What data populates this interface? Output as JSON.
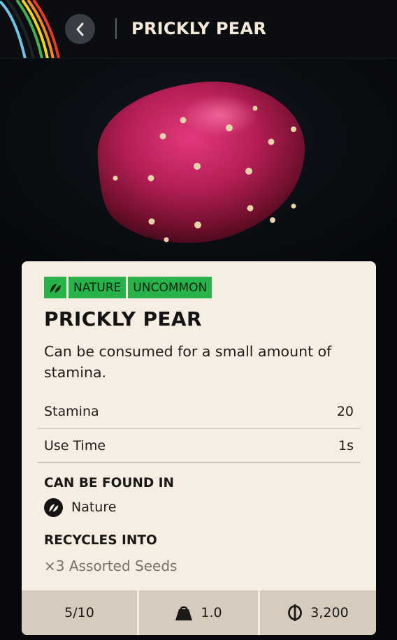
{
  "header": {
    "title": "PRICKLY PEAR"
  },
  "item": {
    "tags": [
      "NATURE",
      "UNCOMMON"
    ],
    "name": "PRICKLY PEAR",
    "description": "Can be consumed for a small amount of stamina.",
    "stats": [
      {
        "label": "Stamina",
        "value": "20"
      },
      {
        "label": "Use Time",
        "value": "1s"
      }
    ],
    "found_in_heading": "CAN BE FOUND IN",
    "found_in": [
      "Nature"
    ],
    "recycles_heading": "RECYCLES INTO",
    "recycles_into": "×3 Assorted Seeds"
  },
  "footer": {
    "stack": "5/10",
    "weight": "1.0",
    "price": "3,200"
  },
  "icons": {
    "back": "chevron-left-icon",
    "nature": "leaf-icon",
    "weight": "weight-icon",
    "currency": "coin-icon"
  },
  "colors": {
    "tag_green": "#27b24a",
    "card_bg": "#f7eee3",
    "footer_bg": "#d6cbbd",
    "header_bg": "#0b0d10"
  }
}
